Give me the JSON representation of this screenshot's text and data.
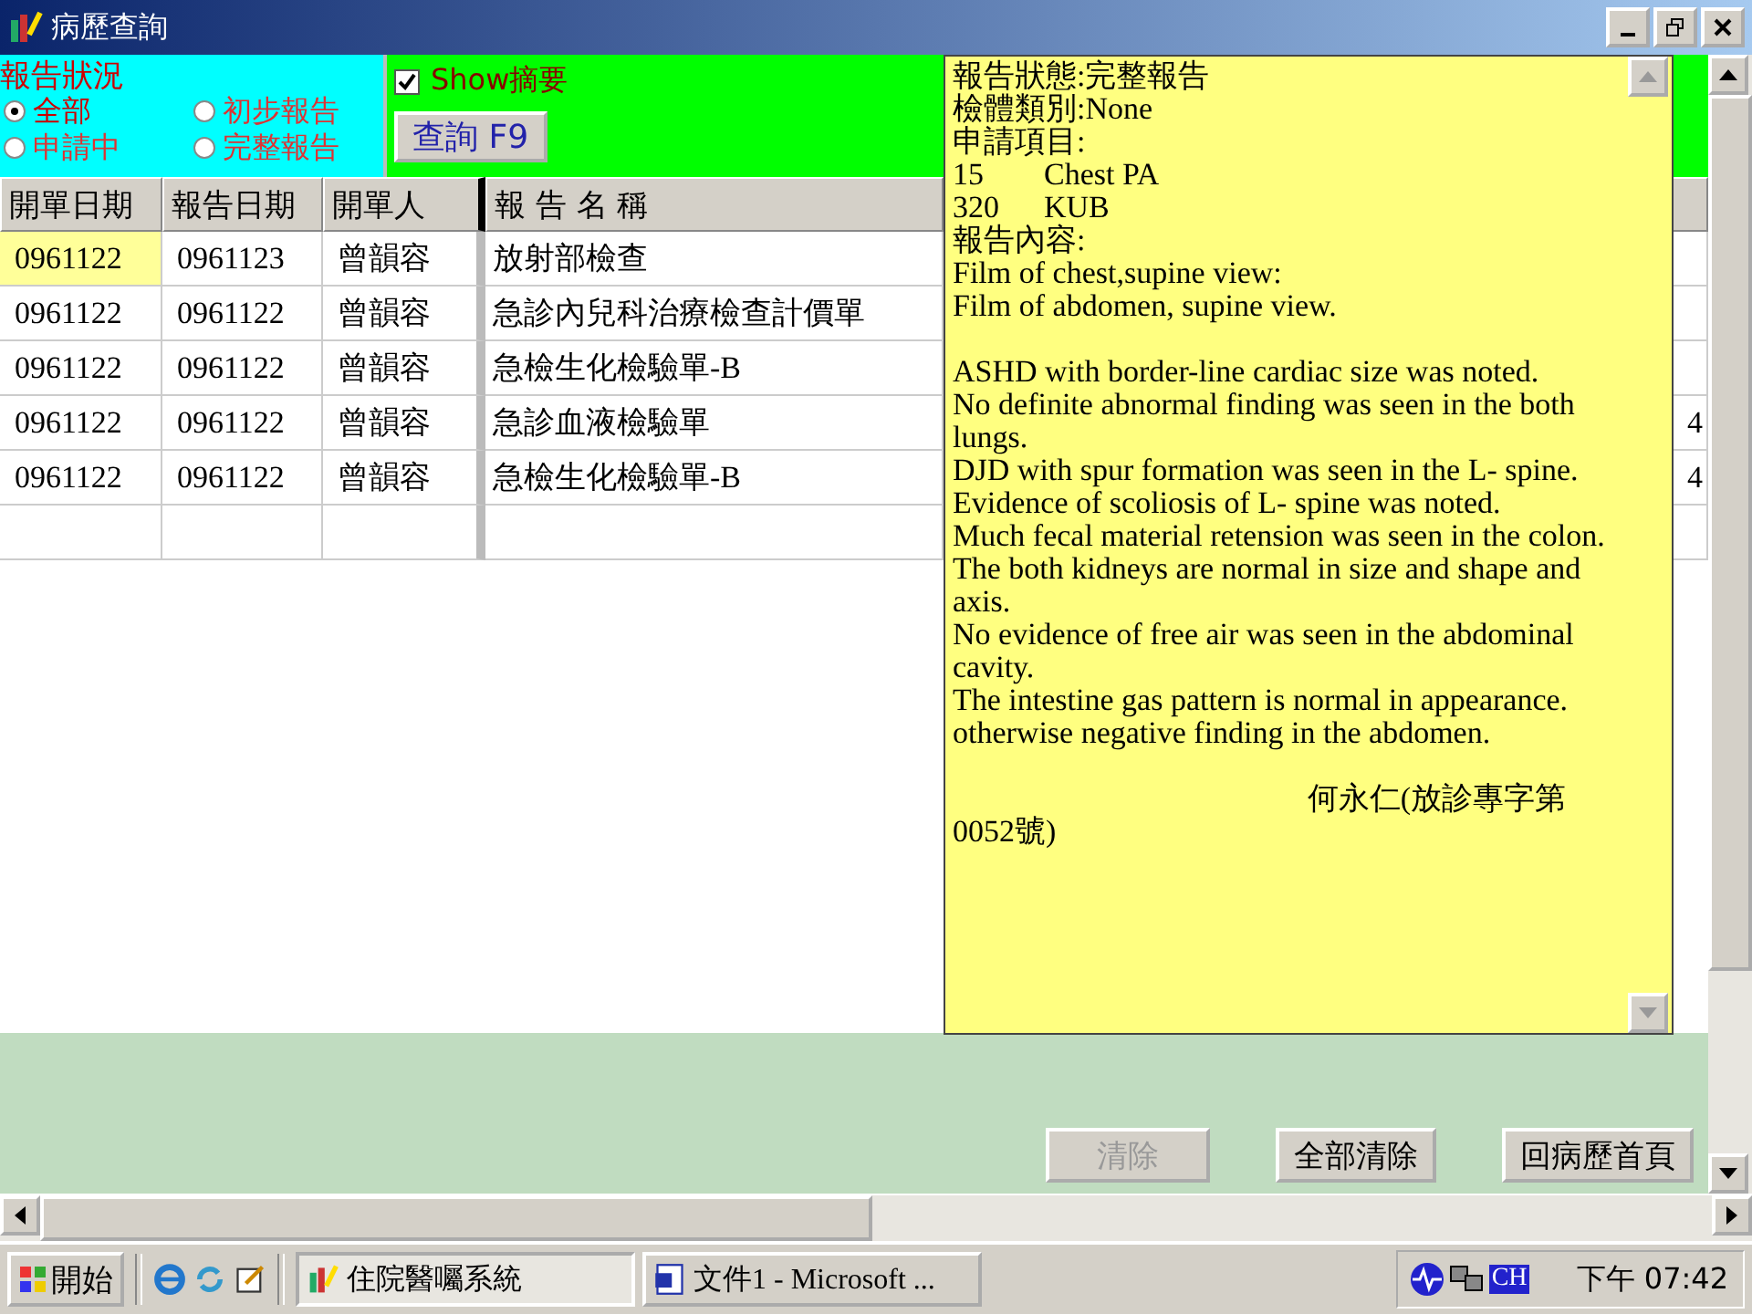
{
  "window": {
    "title": "病歷查詢"
  },
  "report_status": {
    "legend": "報告狀況",
    "options": [
      {
        "label": "全部",
        "selected": true
      },
      {
        "label": "初步報告",
        "selected": false
      },
      {
        "label": "申請中",
        "selected": false
      },
      {
        "label": "完整報告",
        "selected": false
      }
    ]
  },
  "show_summary": {
    "label": "Show摘要",
    "checked": true
  },
  "query_button": "查詢 F9",
  "table": {
    "columns": [
      "開單日期",
      "報告日期",
      "開單人",
      "報 告 名 稱"
    ],
    "rows": [
      {
        "cells": [
          "0961122",
          "0961123",
          "曾韻容",
          "放射部檢查"
        ],
        "selected": true
      },
      {
        "cells": [
          "0961122",
          "0961122",
          "曾韻容",
          "急診內兒科治療檢查計價單"
        ],
        "selected": false
      },
      {
        "cells": [
          "0961122",
          "0961122",
          "曾韻容",
          "急檢生化檢驗單-B"
        ],
        "selected": false
      },
      {
        "cells": [
          "0961122",
          "0961122",
          "曾韻容",
          "急診血液檢驗單"
        ],
        "column_5": "4",
        "selected": false
      },
      {
        "cells": [
          "0961122",
          "0961122",
          "曾韻容",
          "急檢生化檢驗單-B"
        ],
        "column_5": "4",
        "selected": false
      }
    ]
  },
  "report_panel": {
    "lines": [
      {
        "kind": "text",
        "text": "報告狀態:完整報告"
      },
      {
        "kind": "text",
        "text": "檢體類別:None"
      },
      {
        "kind": "text",
        "text": "申請項目:"
      },
      {
        "kind": "item",
        "code": "15",
        "name": "Chest PA"
      },
      {
        "kind": "item",
        "code": "320",
        "name": "KUB"
      },
      {
        "kind": "text",
        "text": "報告內容:"
      },
      {
        "kind": "text",
        "text": "Film of chest,supine view:"
      },
      {
        "kind": "text",
        "text": "Film of abdomen, supine view."
      },
      {
        "kind": "blank"
      },
      {
        "kind": "text",
        "text": "ASHD with border-line cardiac size was noted."
      },
      {
        "kind": "text",
        "text": "No definite abnormal finding was seen in the both lungs."
      },
      {
        "kind": "text",
        "text": "DJD with spur formation was seen in the L- spine."
      },
      {
        "kind": "text",
        "text": "Evidence of scoliosis of L- spine was noted."
      },
      {
        "kind": "text",
        "text": "Much fecal material retension was seen in the colon."
      },
      {
        "kind": "text",
        "text": "The both kidneys are normal in size and shape and axis."
      },
      {
        "kind": "text",
        "text": "No evidence of free air was seen in the abdominal cavity."
      },
      {
        "kind": "text",
        "text": "The intestine gas pattern is normal in appearance."
      },
      {
        "kind": "text",
        "text": "otherwise negative finding in the abdomen."
      },
      {
        "kind": "blank"
      },
      {
        "kind": "signature",
        "text": "何永仁(放診專字第"
      },
      {
        "kind": "text",
        "text": "0052號)"
      }
    ]
  },
  "buttons": [
    {
      "label": "清除",
      "disabled": true
    },
    {
      "label": "全部清除",
      "disabled": false
    },
    {
      "label": "回病歷首頁",
      "disabled": false
    }
  ],
  "taskbar": {
    "start": "開始",
    "tasks": [
      {
        "label": "住院醫囑系統",
        "selected": true
      },
      {
        "label": "文件1 - Microsoft ...",
        "selected": false
      }
    ],
    "tray_text": "CH",
    "clock": "下午 07:42"
  }
}
